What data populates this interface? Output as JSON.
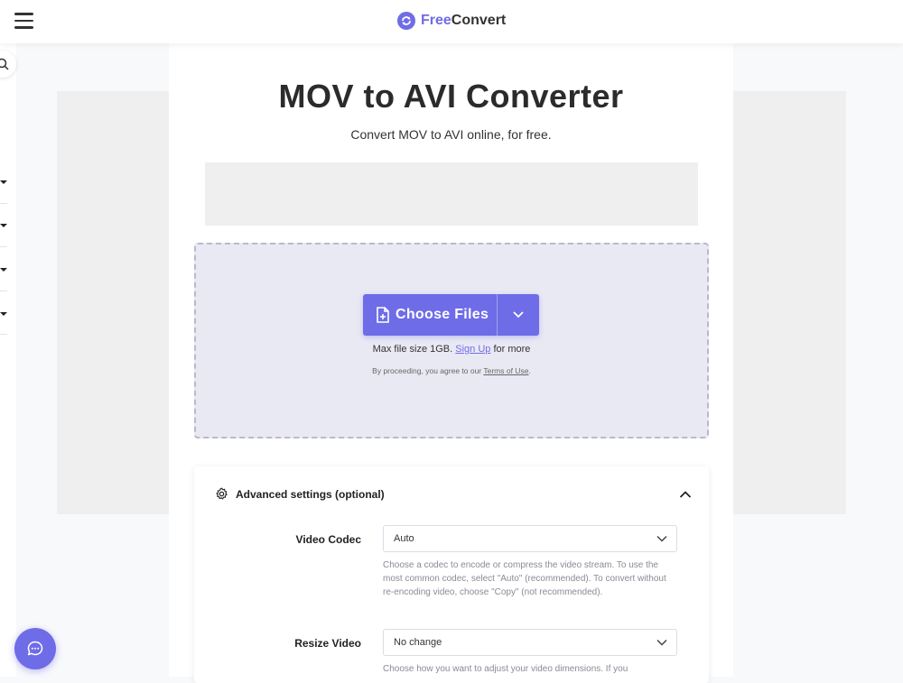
{
  "header": {
    "logo_free": "Free",
    "logo_convert": "Convert",
    "menu_icon": "hamburger-icon",
    "logo_icon": "freeconvert-logo-icon"
  },
  "sidebar": {
    "search_icon": "search-icon"
  },
  "page": {
    "title": "MOV to AVI Converter",
    "subtitle": "Convert MOV to AVI online, for free."
  },
  "upload": {
    "choose_label": "Choose Files",
    "file_icon": "file-plus-icon",
    "dropdown_icon": "chevron-down-icon",
    "max_prefix": "Max file size 1GB.",
    "sign_up": "Sign Up",
    "max_suffix": "for more",
    "terms_prefix": "By proceeding, you agree to our",
    "terms_link": "Terms of Use",
    "terms_suffix": "."
  },
  "advanced": {
    "label": "Advanced settings (optional)",
    "gear_icon": "gear-icon",
    "toggle_icon": "chevron-up-icon",
    "video_codec": {
      "label": "Video Codec",
      "value": "Auto",
      "help": "Choose a codec to encode or compress the video stream. To use the most common codec, select \"Auto\" (recommended). To convert without re-encoding video, choose \"Copy\" (not recommended)."
    },
    "resize_video": {
      "label": "Resize Video",
      "value": "No change",
      "help": "Choose how you want to adjust your video dimensions. If you"
    }
  },
  "chat": {
    "icon": "chat-icon"
  },
  "colors": {
    "accent": "#6f6ce8",
    "dropzone_bg": "#e9e9f4"
  }
}
